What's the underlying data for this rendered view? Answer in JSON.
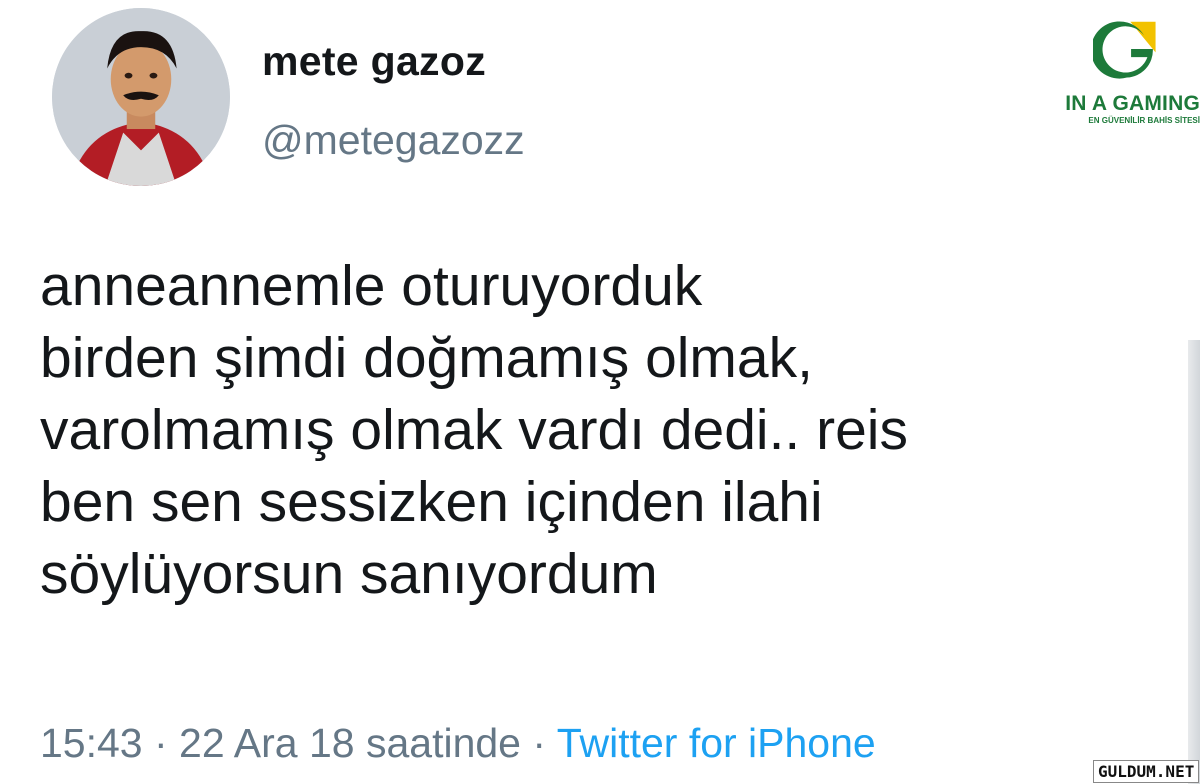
{
  "user": {
    "display_name": "mete gazoz",
    "handle": "@metegazozz",
    "avatar_icon": "profile-photo"
  },
  "tweet": {
    "lines": [
      "anneannemle oturuyorduk",
      "birden şimdi doğmamış olmak,",
      "varolmamış olmak vardı dedi.. reis",
      "ben sen sessizken içinden ilahi",
      "söylüyorsun sanıyordum"
    ]
  },
  "meta": {
    "time": "15:43",
    "separator": " · ",
    "date": "22 Ara 18 saatinde",
    "source": "Twitter for iPhone"
  },
  "brand": {
    "name": "IN A GAMING",
    "tagline": "EN GÜVENİLİR BAHİS SİTESİ",
    "colors": {
      "green": "#1d7a3a",
      "yellow": "#f2c200"
    }
  },
  "watermark": {
    "text": "GULDUM.NET"
  },
  "colors": {
    "text": "#14171a",
    "muted": "#657786",
    "link": "#1da1f2"
  }
}
